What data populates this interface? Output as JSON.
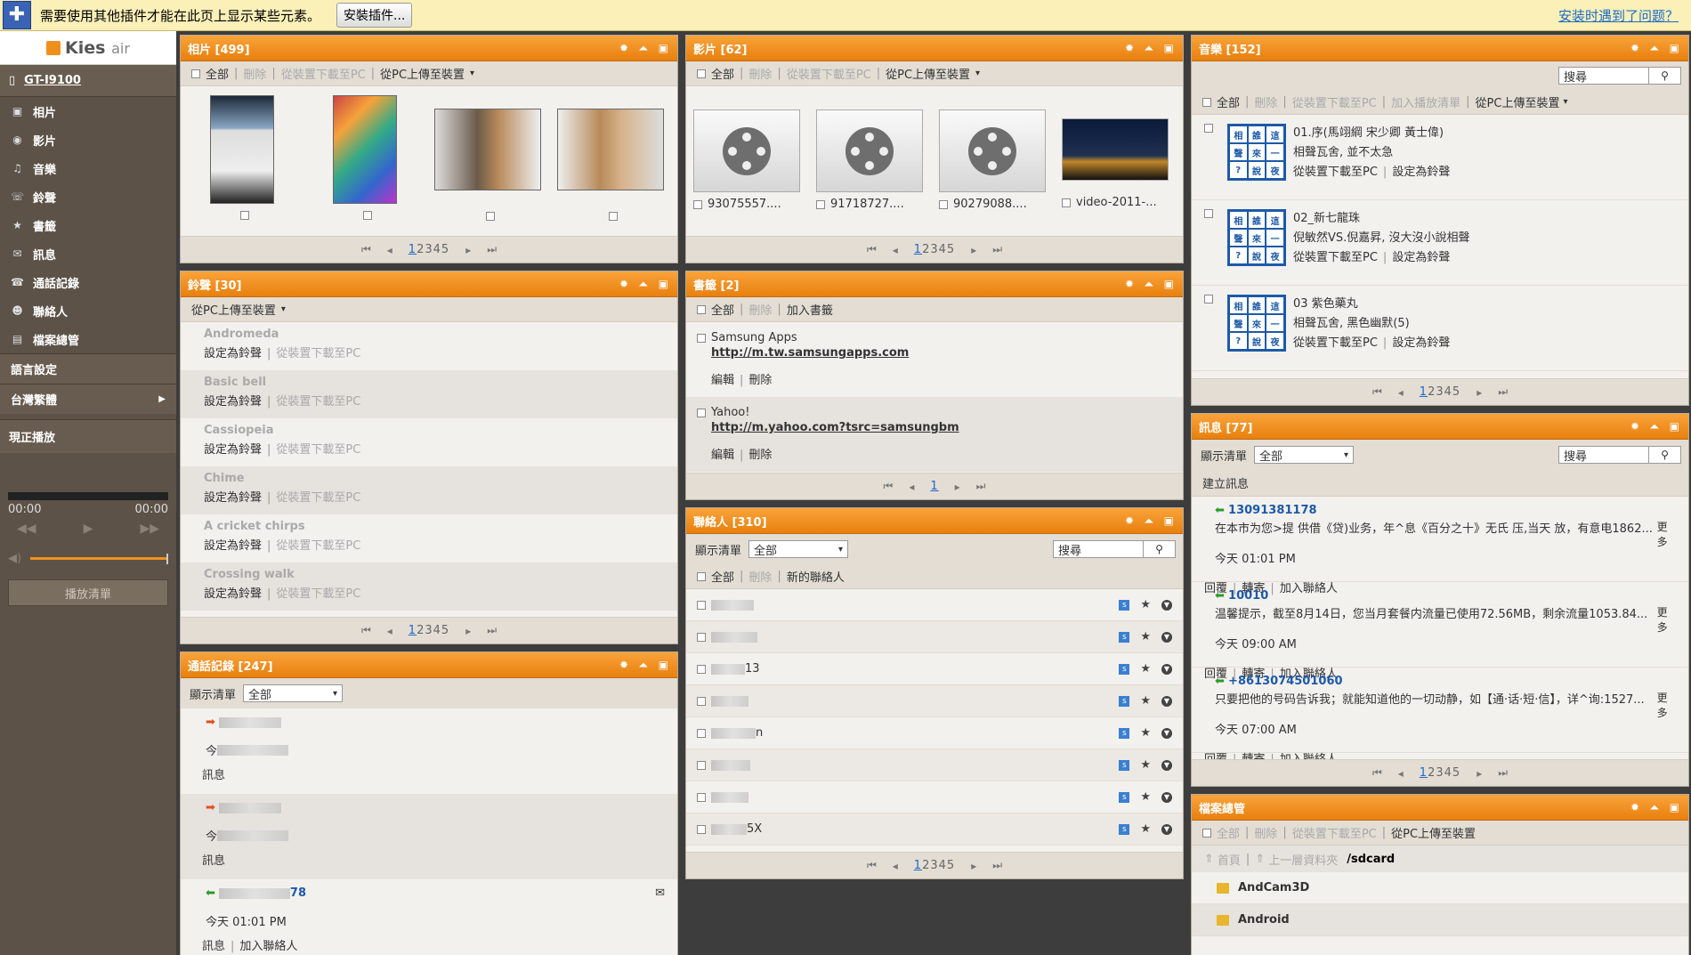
{
  "infobar": {
    "message": "需要使用其他插件才能在此页上显示某些元素。",
    "install_label": "安裝插件...",
    "help_link": "安装时遇到了问题？"
  },
  "sidebar": {
    "logo": "Kies",
    "logo_sub": "air",
    "device": "GT-I9100",
    "items": [
      {
        "label": "相片",
        "icon": "photo-icon"
      },
      {
        "label": "影片",
        "icon": "video-icon"
      },
      {
        "label": "音樂",
        "icon": "music-icon"
      },
      {
        "label": "鈴聲",
        "icon": "ringtone-icon"
      },
      {
        "label": "書籤",
        "icon": "bookmark-icon"
      },
      {
        "label": "訊息",
        "icon": "message-icon"
      },
      {
        "label": "通話記錄",
        "icon": "call-log-icon"
      },
      {
        "label": "聯絡人",
        "icon": "contact-icon"
      },
      {
        "label": "檔案總管",
        "icon": "file-manager-icon"
      }
    ],
    "language": "語言設定",
    "region": "台灣繁體",
    "now_playing": "現正播放",
    "time_start": "00:00",
    "time_end": "00:00",
    "playlist_label": "播放清單"
  },
  "common": {
    "all": "全部",
    "delete": "刪除",
    "download": "從裝置下載至PC",
    "upload": "從PC上傳至裝置",
    "set_ringtone": "設定為鈴聲",
    "search": "搜尋",
    "filter_label": "顯示清單",
    "filter_value": "全部",
    "pages": [
      "1",
      "2",
      "3",
      "4",
      "5"
    ],
    "edit": "編輯",
    "reply": "回覆",
    "forward": "轉寄",
    "add_contact": "加入聯絡人",
    "more": "更多",
    "add_playlist": "加入播放清單"
  },
  "photos": {
    "title": "相片 [499]"
  },
  "videos": {
    "title": "影片 [62]",
    "items": [
      "93075557....",
      "91718727....",
      "90279088....",
      "video-2011-..."
    ]
  },
  "music": {
    "title": "音樂 [152]",
    "songs": [
      {
        "name": "01.序(馬翊綱 宋少卿 黃士偉)",
        "artist": "相聲瓦舍, 並不太急"
      },
      {
        "name": "02_新七龍珠",
        "artist": "倪敏然VS.倪嘉昇, 沒大沒小說相聲"
      },
      {
        "name": "03 紫色藥丸",
        "artist": "相聲瓦舍, 黑色幽默(5)"
      }
    ],
    "cover_chars": [
      "相",
      "誰",
      "這",
      "聲",
      "來",
      "一",
      "?",
      "說",
      "夜"
    ]
  },
  "ringtones": {
    "title": "鈴聲 [30]",
    "items": [
      "Andromeda",
      "Basic bell",
      "Cassiopeia",
      "Chime",
      "A cricket chirps",
      "Crossing walk"
    ]
  },
  "bookmarks": {
    "title": "書籤 [2]",
    "add_label": "加入書籤",
    "page": "1",
    "items": [
      {
        "name": "Samsung Apps",
        "url": "http://m.tw.samsungapps.com"
      },
      {
        "name": "Yahoo!",
        "url": "http://m.yahoo.com?tsrc=samsungbm"
      }
    ]
  },
  "messages": {
    "title": "訊息 [77]",
    "new_label": "建立訊息",
    "items": [
      {
        "from": "13091381178",
        "body": "在本市为您>提 供借《贷)业务，年^息《百分之十》无氏 压,当天 放，有意电1862...",
        "time": "今天 01:01 PM"
      },
      {
        "from": "10010",
        "body": "温馨提示，截至8月14日，您当月套餐内流量已使用72.56MB，剩余流量1053.84...",
        "time": "今天 09:00 AM"
      },
      {
        "from": "+8613074501060",
        "body": "只要把他的号码告诉我；就能知道他的一切动静，如【通·话·短·信】，详^询:1527...",
        "time": "今天 07:00 AM"
      }
    ]
  },
  "calllog": {
    "title": "通話記錄 [247]",
    "today": "今",
    "msg": "訊息",
    "last_suffix": "78",
    "last_time": "今天 01:01 PM",
    "msg_label": "訊息"
  },
  "contacts": {
    "title": "聯絡人 [310]",
    "new_label": "新的聯絡人",
    "suffixes": [
      "",
      "",
      "13",
      "",
      "n",
      "",
      "",
      "5X"
    ]
  },
  "files": {
    "title": "檔案總管",
    "home": "首頁",
    "up": "上一層資料夾",
    "path": "/sdcard",
    "folders": [
      "AndCam3D",
      "Android"
    ]
  }
}
